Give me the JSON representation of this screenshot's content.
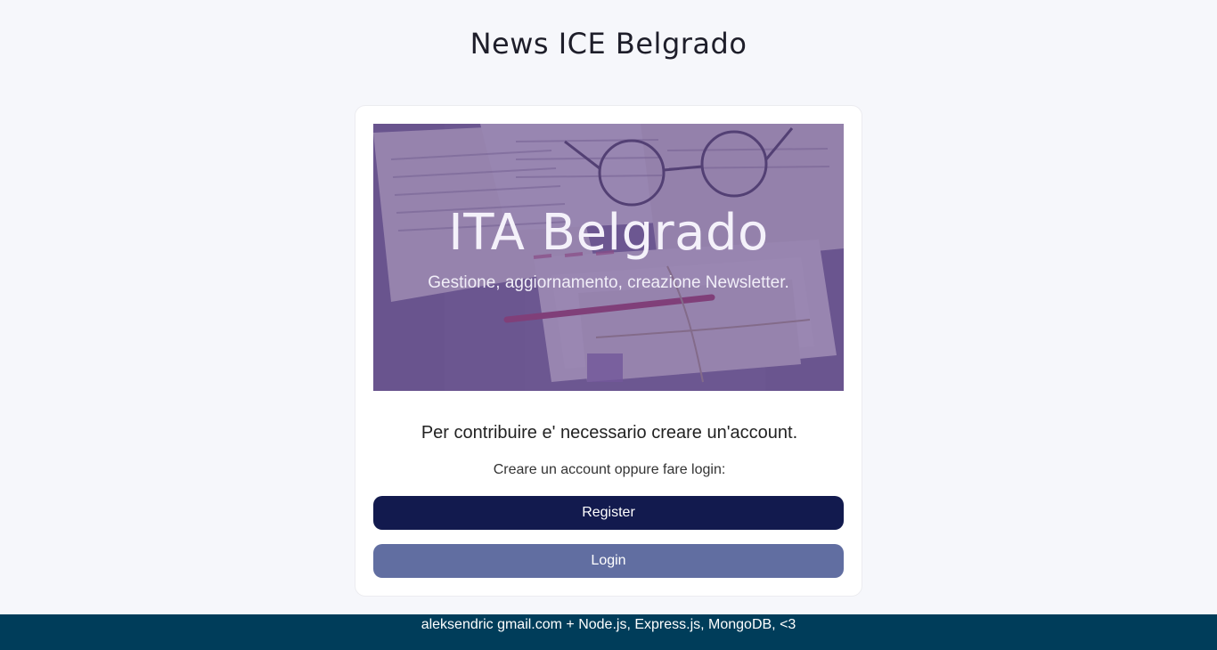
{
  "header": {
    "title": "News ICE Belgrado"
  },
  "hero": {
    "title": "ITA Belgrado",
    "subtitle": "Gestione, aggiornamento, creazione Newsletter.",
    "overlay_color": "#6248949e"
  },
  "main": {
    "intro_text": "Per contribuire e' necessario creare un'account.",
    "prompt_text": "Creare un account oppure fare login:",
    "register_label": "Register",
    "login_label": "Login"
  },
  "footer": {
    "text": "aleksendric gmail.com + Node.js, Express.js, MongoDB, <3"
  },
  "colors": {
    "page_background": "#f6f7fb",
    "register_button": "#121a4e",
    "login_button": "#616ea1",
    "footer_background": "#003d5a"
  }
}
